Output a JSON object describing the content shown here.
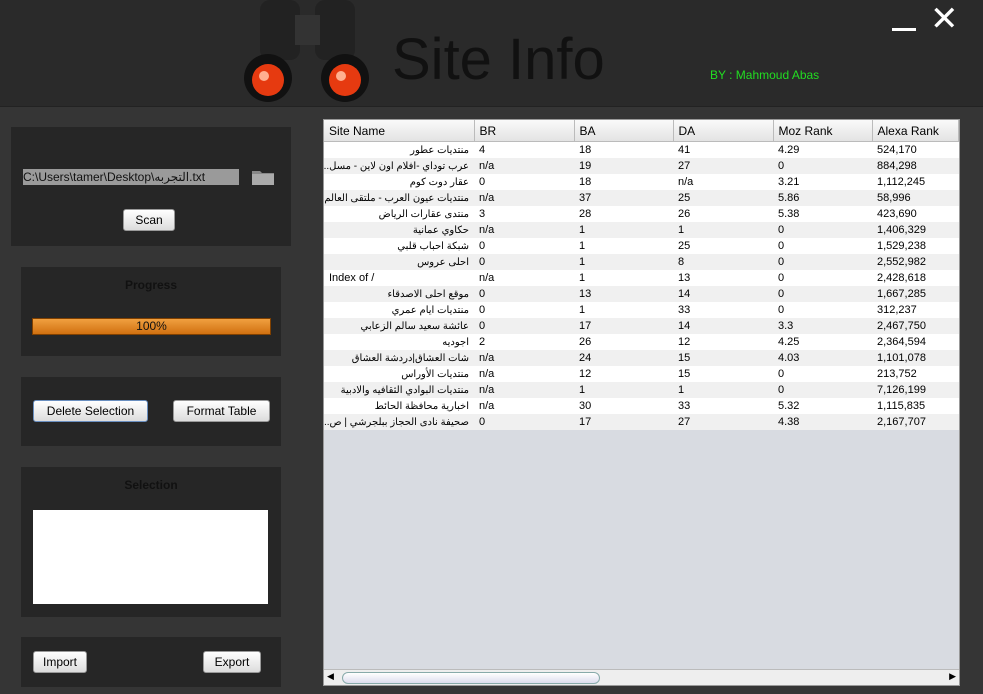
{
  "header": {
    "title": "Site Info",
    "author": "BY : Mahmoud Abas"
  },
  "file": {
    "path": "C:\\Users\\tamer\\Desktop\\التجربه.txt",
    "scan_label": "Scan"
  },
  "progress": {
    "title": "Progress",
    "label": "100%",
    "value": 100
  },
  "actions": {
    "delete_label": "Delete Selection",
    "format_label": "Format Table"
  },
  "selection": {
    "title": "Selection",
    "value": ""
  },
  "io": {
    "import_label": "Import",
    "export_label": "Export"
  },
  "table": {
    "columns": [
      "Site Name",
      "BR",
      "BA",
      "DA",
      "Moz Rank",
      "Alexa Rank"
    ],
    "rows": [
      [
        "منتديات عطور",
        "4",
        "18",
        "41",
        "4.29",
        "524,170"
      ],
      [
        "عرب توداي -افلام اون لاين - مسل...",
        "n/a",
        "19",
        "27",
        "0",
        "884,298"
      ],
      [
        "عقار دوت كوم",
        "0",
        "18",
        "n/a",
        "3.21",
        "1,112,245"
      ],
      [
        "منتديات عيون العرب - ملتقى العالم ...",
        "n/a",
        "37",
        "25",
        "5.86",
        "58,996"
      ],
      [
        "منتدى عقارات الرياض",
        "3",
        "28",
        "26",
        "5.38",
        "423,690"
      ],
      [
        "حكاوي عمانية",
        "n/a",
        "1",
        "1",
        "0",
        "1,406,329"
      ],
      [
        "شبكة احباب قلبي",
        "0",
        "1",
        "25",
        "0",
        "1,529,238"
      ],
      [
        "احلى عروس",
        "0",
        "1",
        "8",
        "0",
        "2,552,982"
      ],
      [
        "Index of /",
        "n/a",
        "1",
        "13",
        "0",
        "2,428,618"
      ],
      [
        "موقع احلى الاصدقاء",
        "0",
        "13",
        "14",
        "0",
        "1,667,285"
      ],
      [
        "منتديات ايام عمري",
        "0",
        "1",
        "33",
        "0",
        "312,237"
      ],
      [
        "عائشة سعيد سالم الزعابي",
        "0",
        "17",
        "14",
        "3.3",
        "2,467,750"
      ],
      [
        "اجوديه",
        "2",
        "26",
        "12",
        "4.25",
        "2,364,594"
      ],
      [
        "شات العشاق|دردشة العشاق",
        "n/a",
        "24",
        "15",
        "4.03",
        "1,101,078"
      ],
      [
        "منتديات الأوراس",
        "n/a",
        "12",
        "15",
        "0",
        "213,752"
      ],
      [
        "منتديات البوادي الثقافيه والادبية",
        "n/a",
        "1",
        "1",
        "0",
        "7,126,199"
      ],
      [
        "اخبارية محافظة الحائط",
        "n/a",
        "30",
        "33",
        "5.32",
        "1,115,835"
      ],
      [
        "صحيفة نادى الحجاز ببلجرشي | ص...",
        "0",
        "17",
        "27",
        "4.38",
        "2,167,707"
      ]
    ]
  }
}
